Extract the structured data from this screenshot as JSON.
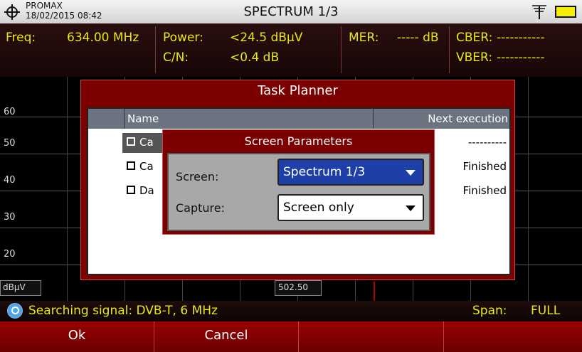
{
  "header": {
    "brand": "PROMAX",
    "datetime": "18/02/2015 08:42",
    "title": "SPECTRUM 1/3",
    "icons": [
      "crosshair-logo-icon",
      "antenna-icon",
      "battery-plug-icon"
    ]
  },
  "measurements": {
    "freq_label": "Freq:",
    "freq_value": "634.00 MHz",
    "power_label": "Power:",
    "power_value": "<24.5 dBµV",
    "cn_label": "C/N:",
    "cn_value": "<0.4 dB",
    "mer_label": "MER:",
    "mer_value": "----- dB",
    "cber_label": "CBER:",
    "cber_value": "-----------",
    "vber_label": "VBER:",
    "vber_value": "-----------"
  },
  "graph": {
    "y_labels": [
      "60",
      "50",
      "40",
      "30",
      "20"
    ],
    "unit": "dBµV",
    "center_freq": "502.50"
  },
  "task_planner": {
    "title": "Task Planner",
    "columns": [
      "Name",
      "Next execution"
    ],
    "rows": [
      {
        "name": "Ca",
        "next": "----------"
      },
      {
        "name": "Ca",
        "next": "Finished"
      },
      {
        "name": "Da",
        "next": "Finished"
      }
    ]
  },
  "screen_parameters": {
    "title": "Screen Parameters",
    "screen_label": "Screen:",
    "screen_value": "Spectrum 1/3",
    "capture_label": "Capture:",
    "capture_value": "Screen only"
  },
  "status": {
    "searching": "Searching signal: DVB-T, 6 MHz",
    "span_label": "Span:",
    "span_value": "FULL"
  },
  "softkeys": [
    "Ok",
    "Cancel",
    "",
    "",
    ""
  ],
  "colors": {
    "accent_red": "#7d0000",
    "measurement_yellow": "#e8e817",
    "selection_blue": "#1e3ea8",
    "battery_yellow": "#f5f000"
  }
}
